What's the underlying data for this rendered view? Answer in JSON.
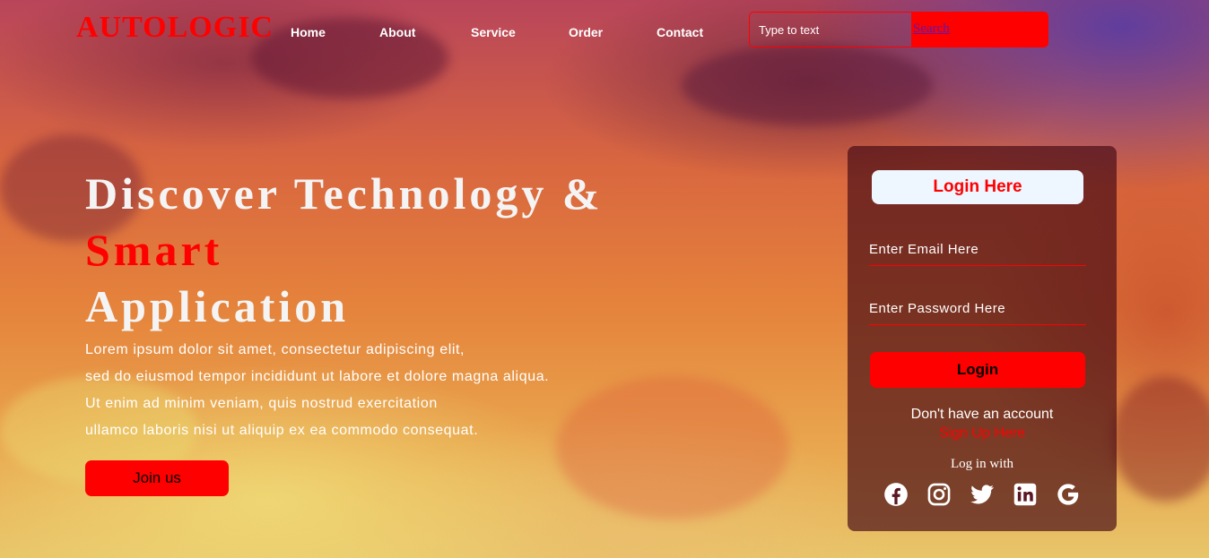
{
  "header": {
    "logo": "AUTOLOGIC",
    "nav": [
      {
        "label": "Home"
      },
      {
        "label": "About"
      },
      {
        "label": "Service"
      },
      {
        "label": "Order"
      },
      {
        "label": "Contact"
      }
    ],
    "search": {
      "placeholder": "Type to text",
      "button_label": "Search"
    }
  },
  "hero": {
    "title_line1": "Discover Technology &",
    "title_accent": "Smart",
    "title_line3": "Application",
    "description": [
      "Lorem ipsum dolor sit amet, consectetur adipiscing elit,",
      "sed do eiusmod tempor incididunt ut labore et dolore magna aliqua.",
      "Ut enim ad minim veniam, quis nostrud exercitation",
      "ullamco laboris nisi ut aliquip ex ea commodo consequat."
    ],
    "join_button": "Join us"
  },
  "login": {
    "heading": "Login Here",
    "email_placeholder": "Enter Email Here",
    "password_placeholder": "Enter Password Here",
    "login_button": "Login",
    "no_account_text": "Don't have an account",
    "signup_link": "Sign Up Here",
    "login_with": "Log in with",
    "socials": [
      {
        "icon": "facebook-icon"
      },
      {
        "icon": "instagram-icon"
      },
      {
        "icon": "twitter-icon"
      },
      {
        "icon": "linkedin-icon"
      },
      {
        "icon": "google-icon"
      }
    ]
  },
  "colors": {
    "accent": "#ff0000",
    "panel_bg": "rgba(70,10,20,0.68)",
    "login_heading_bg": "#eef6ff",
    "text": "#ffffff"
  }
}
